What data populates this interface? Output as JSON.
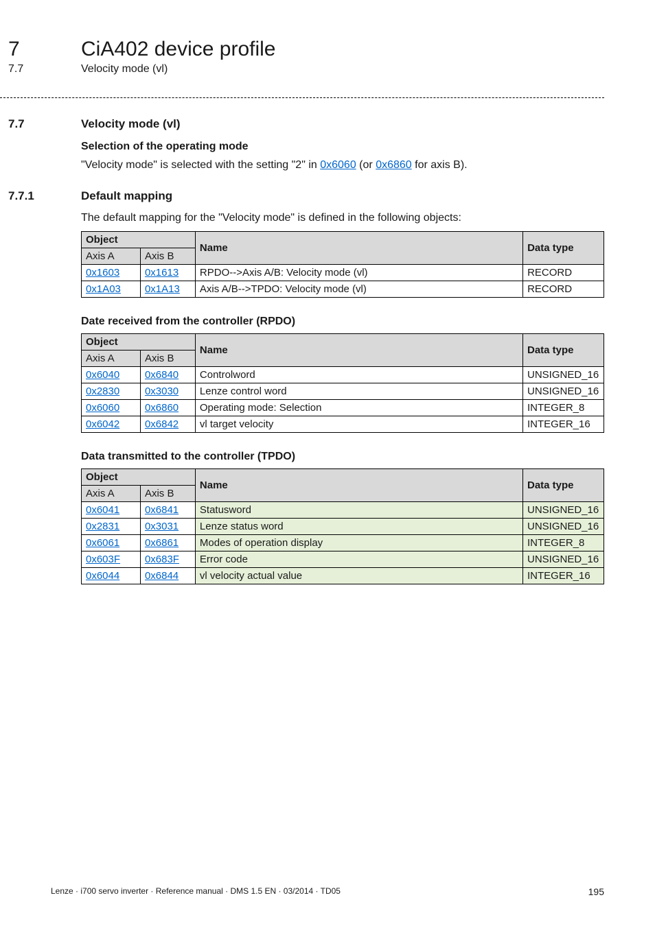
{
  "header": {
    "chapter_number": "7",
    "chapter_title": "CiA402 device profile",
    "sub_number": "7.7",
    "sub_title": "Velocity mode (vl)"
  },
  "section_7_7": {
    "number": "7.7",
    "title": "Velocity mode (vl)",
    "selection_heading": "Selection of the operating mode",
    "selection_text_pre": "\"Velocity mode\" is selected with the setting \"2\" in ",
    "selection_link1": "0x6060",
    "selection_text_mid": " (or ",
    "selection_link2": "0x6860",
    "selection_text_post": " for axis B)."
  },
  "section_7_7_1": {
    "number": "7.7.1",
    "title": "Default mapping",
    "intro": "The default mapping for the \"Velocity mode\" is defined in the following objects:"
  },
  "table_headers": {
    "object": "Object",
    "axis_a": "Axis A",
    "axis_b": "Axis B",
    "name": "Name",
    "data_type": "Data type"
  },
  "default_table": {
    "rows": [
      {
        "a": "0x1603",
        "b": "0x1613",
        "name": "RPDO-->Axis A/B: Velocity mode (vl)",
        "type": "RECORD"
      },
      {
        "a": "0x1A03",
        "b": "0x1A13",
        "name": "Axis A/B-->TPDO: Velocity mode (vl)",
        "type": "RECORD"
      }
    ]
  },
  "rpdo_heading": "Date received from the controller (RPDO)",
  "rpdo_table": {
    "rows": [
      {
        "a": "0x6040",
        "b": "0x6840",
        "name": "Controlword",
        "type": "UNSIGNED_16"
      },
      {
        "a": "0x2830",
        "b": "0x3030",
        "name": "Lenze control word",
        "type": "UNSIGNED_16"
      },
      {
        "a": "0x6060",
        "b": "0x6860",
        "name": "Operating mode: Selection",
        "type": "INTEGER_8"
      },
      {
        "a": "0x6042",
        "b": "0x6842",
        "name": "vl target velocity",
        "type": "INTEGER_16"
      }
    ]
  },
  "tpdo_heading": "Data transmitted to the controller (TPDO)",
  "tpdo_table": {
    "rows": [
      {
        "a": "0x6041",
        "b": "0x6841",
        "name": "Statusword",
        "type": "UNSIGNED_16"
      },
      {
        "a": "0x2831",
        "b": "0x3031",
        "name": "Lenze status word",
        "type": "UNSIGNED_16"
      },
      {
        "a": "0x6061",
        "b": "0x6861",
        "name": "Modes of operation display",
        "type": "INTEGER_8"
      },
      {
        "a": "0x603F",
        "b": "0x683F",
        "name": "Error code",
        "type": "UNSIGNED_16"
      },
      {
        "a": "0x6044",
        "b": "0x6844",
        "name": "vl velocity actual value",
        "type": "INTEGER_16"
      }
    ]
  },
  "footer": {
    "left": "Lenze · i700 servo inverter · Reference manual · DMS 1.5 EN · 03/2014 · TD05",
    "page": "195"
  }
}
